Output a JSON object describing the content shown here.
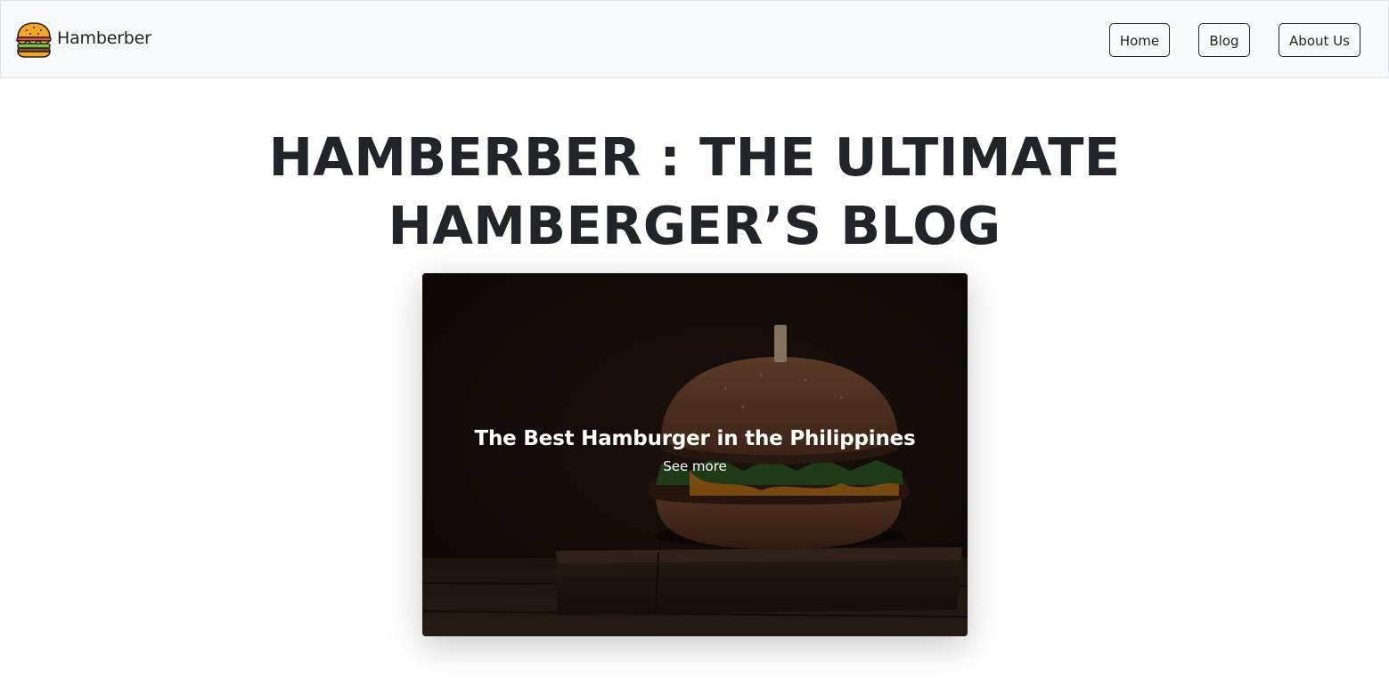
{
  "navbar": {
    "brand": {
      "name": "Hamberber",
      "icon": "hamburger-logo-icon"
    },
    "links": [
      {
        "label": "Home"
      },
      {
        "label": "Blog"
      },
      {
        "label": "About Us"
      }
    ]
  },
  "hero": {
    "title": "HAMBERBER : THE ULTIMATE HAMBERGER’S BLOG"
  },
  "featured_card": {
    "image": "burger-on-wooden-board-photo",
    "title": "The Best Hamburger in the Philippines",
    "link_label": "See more"
  },
  "colors": {
    "navbar_bg": "#f8f9fa",
    "text": "#212529",
    "card_overlay_text": "#ffffff"
  }
}
